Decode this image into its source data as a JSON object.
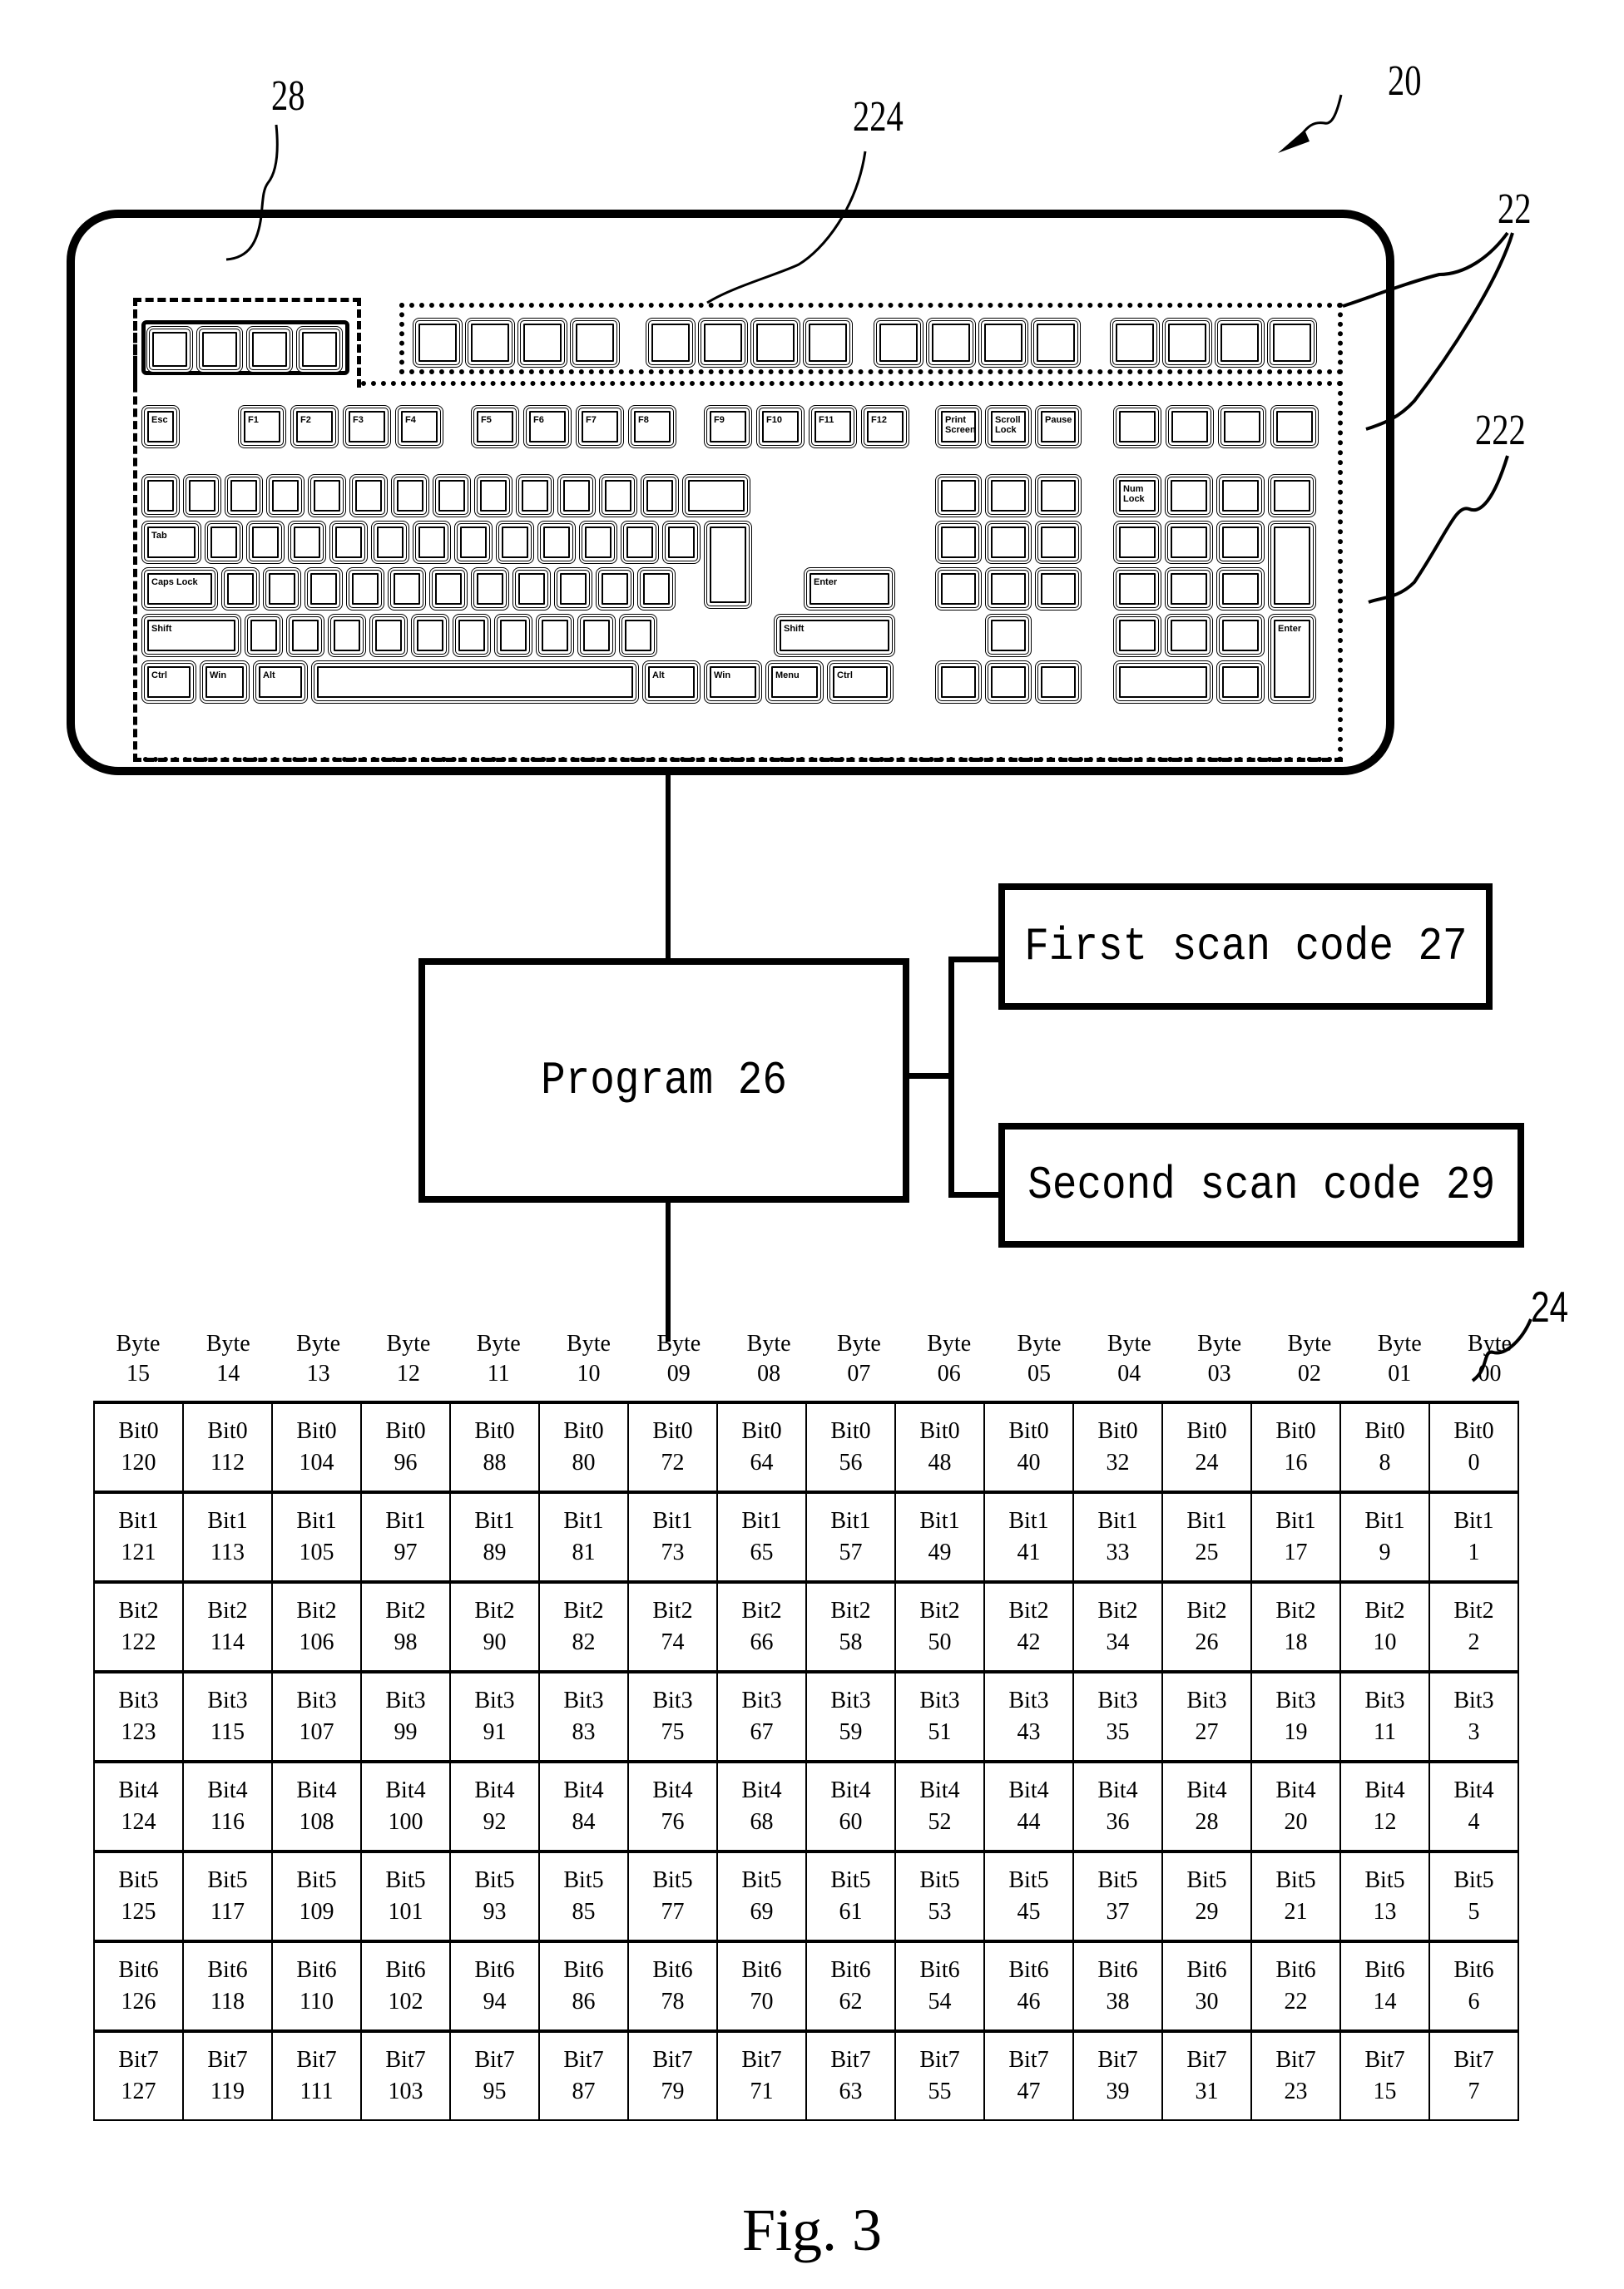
{
  "figure": {
    "caption": "Fig. 3",
    "reference_labels": {
      "keyboard_assembly": "20",
      "key_array": "22",
      "first_key_group": "222",
      "second_key_group": "224",
      "keyboard_body": "28",
      "bit_table": "24"
    }
  },
  "keyboard": {
    "function_row_keys": [
      "Esc",
      "F1",
      "F2",
      "F3",
      "F4",
      "F5",
      "F6",
      "F7",
      "F8",
      "F9",
      "F10",
      "F11",
      "F12",
      "Print Screen",
      "Scroll Lock",
      "Pause"
    ],
    "bottom_row_keys": [
      "Ctrl",
      "Win",
      "Alt",
      "",
      "Alt",
      "Win",
      "Menu",
      "Ctrl"
    ],
    "modifier_labels": {
      "tab": "Tab",
      "caps": "Caps Lock",
      "shift_left": "Shift",
      "shift_right": "Shift",
      "enter": "Enter",
      "num_enter": "Enter",
      "num_lock": "Num Lock"
    }
  },
  "program": {
    "label": "Program 26"
  },
  "scan_codes": {
    "first": "First scan code 27",
    "second": "Second scan code 29"
  },
  "bit_table": {
    "byte_headers": [
      [
        "Byte",
        "15"
      ],
      [
        "Byte",
        "14"
      ],
      [
        "Byte",
        "13"
      ],
      [
        "Byte",
        "12"
      ],
      [
        "Byte",
        "11"
      ],
      [
        "Byte",
        "10"
      ],
      [
        "Byte",
        "09"
      ],
      [
        "Byte",
        "08"
      ],
      [
        "Byte",
        "07"
      ],
      [
        "Byte",
        "06"
      ],
      [
        "Byte",
        "05"
      ],
      [
        "Byte",
        "04"
      ],
      [
        "Byte",
        "03"
      ],
      [
        "Byte",
        "02"
      ],
      [
        "Byte",
        "01"
      ],
      [
        "Byte",
        "00"
      ]
    ],
    "rows": [
      {
        "bit": "Bit0",
        "values": [
          "120",
          "112",
          "104",
          "96",
          "88",
          "80",
          "72",
          "64",
          "56",
          "48",
          "40",
          "32",
          "24",
          "16",
          "8",
          "0"
        ]
      },
      {
        "bit": "Bit1",
        "values": [
          "121",
          "113",
          "105",
          "97",
          "89",
          "81",
          "73",
          "65",
          "57",
          "49",
          "41",
          "33",
          "25",
          "17",
          "9",
          "1"
        ]
      },
      {
        "bit": "Bit2",
        "values": [
          "122",
          "114",
          "106",
          "98",
          "90",
          "82",
          "74",
          "66",
          "58",
          "50",
          "42",
          "34",
          "26",
          "18",
          "10",
          "2"
        ]
      },
      {
        "bit": "Bit3",
        "values": [
          "123",
          "115",
          "107",
          "99",
          "91",
          "83",
          "75",
          "67",
          "59",
          "51",
          "43",
          "35",
          "27",
          "19",
          "11",
          "3"
        ]
      },
      {
        "bit": "Bit4",
        "values": [
          "124",
          "116",
          "108",
          "100",
          "92",
          "84",
          "76",
          "68",
          "60",
          "52",
          "44",
          "36",
          "28",
          "20",
          "12",
          "4"
        ]
      },
      {
        "bit": "Bit5",
        "values": [
          "125",
          "117",
          "109",
          "101",
          "93",
          "85",
          "77",
          "69",
          "61",
          "53",
          "45",
          "37",
          "29",
          "21",
          "13",
          "5"
        ]
      },
      {
        "bit": "Bit6",
        "values": [
          "126",
          "118",
          "110",
          "102",
          "94",
          "86",
          "78",
          "70",
          "62",
          "54",
          "46",
          "38",
          "30",
          "22",
          "14",
          "6"
        ]
      },
      {
        "bit": "Bit7",
        "values": [
          "127",
          "119",
          "111",
          "103",
          "95",
          "87",
          "79",
          "71",
          "63",
          "55",
          "47",
          "39",
          "31",
          "23",
          "15",
          "7"
        ]
      }
    ]
  }
}
